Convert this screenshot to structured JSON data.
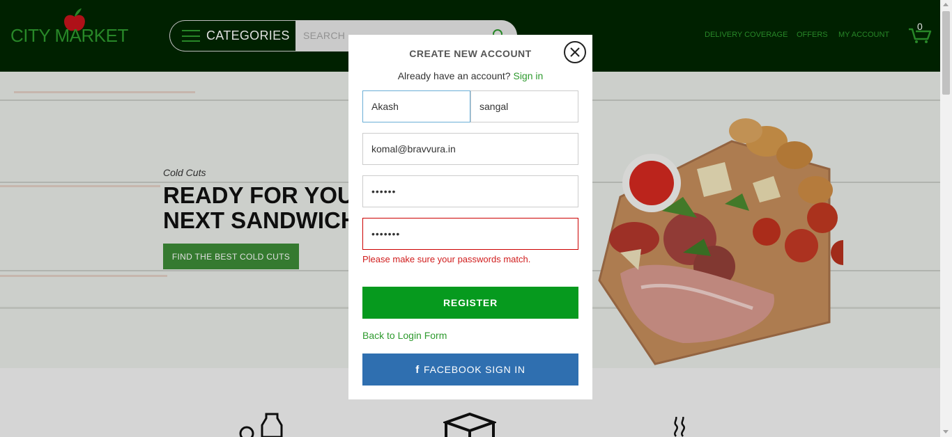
{
  "header": {
    "logo_text": "CITY MARKET",
    "categories_label": "CATEGORIES",
    "search_placeholder": "SEARCH",
    "nav": {
      "delivery": "DELIVERY COVERAGE",
      "offers": "OFFERS",
      "account": "MY ACCOUNT"
    },
    "cart_count": "0"
  },
  "hero": {
    "subtitle": "Cold Cuts",
    "title_line1": "READY FOR YOUR",
    "title_line2": "NEXT SANDWICH",
    "cta_label": "FIND THE BEST COLD CUTS"
  },
  "modal": {
    "title": "CREATE NEW ACCOUNT",
    "signin_prompt": "Already have an account?",
    "signin_link": "Sign in",
    "first_name": "Akash",
    "last_name": "sangal",
    "email": "komal@bravvura.in",
    "password": "••••••",
    "confirm_password": "•••••••",
    "error_message": "Please make sure your passwords match.",
    "register_label": "REGISTER",
    "back_link": "Back to Login Form",
    "facebook_icon": "f",
    "facebook_label": "FACEBOOK SIGN IN"
  },
  "colors": {
    "header_bg": "#002600",
    "brand_green": "#2e9a2e",
    "register_green": "#069a1e",
    "facebook_blue": "#2f6fb0",
    "error_red": "#d01c1c"
  },
  "icons": [
    "apple-icon",
    "hamburger-icon",
    "search-icon",
    "cart-icon",
    "close-icon",
    "facebook-icon",
    "bottle-icon",
    "box-icon",
    "steam-icon"
  ]
}
